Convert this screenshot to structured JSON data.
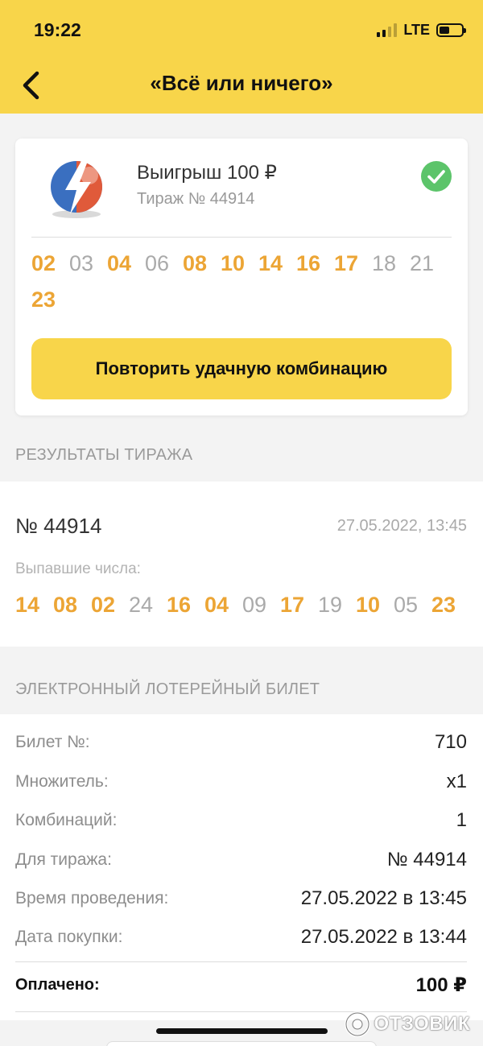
{
  "status_bar": {
    "time": "19:22",
    "network": "LTE",
    "battery_icon": "battery-icon",
    "signal_icon": "signal-icon"
  },
  "nav": {
    "back_icon": "chevron-left-icon",
    "title": "«Всё или ничего»"
  },
  "win_card": {
    "logo_icon": "lightning-ball-logo",
    "title": "Выигрыш 100 ₽",
    "draw": "Тираж № 44914",
    "status_icon": "check-circle-icon",
    "numbers": [
      {
        "n": "02",
        "hit": true
      },
      {
        "n": "03",
        "hit": false
      },
      {
        "n": "04",
        "hit": true
      },
      {
        "n": "06",
        "hit": false
      },
      {
        "n": "08",
        "hit": true
      },
      {
        "n": "10",
        "hit": true
      },
      {
        "n": "14",
        "hit": true
      },
      {
        "n": "16",
        "hit": true
      },
      {
        "n": "17",
        "hit": true
      },
      {
        "n": "18",
        "hit": false
      },
      {
        "n": "21",
        "hit": false
      },
      {
        "n": "23",
        "hit": true
      }
    ],
    "repeat_button": "Повторить удачную комбинацию"
  },
  "results": {
    "section_title": "РЕЗУЛЬТАТЫ ТИРАЖА",
    "draw_no": "№ 44914",
    "date": "27.05.2022, 13:45",
    "drawn_label": "Выпавшие числа:",
    "numbers": [
      {
        "n": "14",
        "hit": true
      },
      {
        "n": "08",
        "hit": true
      },
      {
        "n": "02",
        "hit": true
      },
      {
        "n": "24",
        "hit": false
      },
      {
        "n": "16",
        "hit": true
      },
      {
        "n": "04",
        "hit": true
      },
      {
        "n": "09",
        "hit": false
      },
      {
        "n": "17",
        "hit": true
      },
      {
        "n": "19",
        "hit": false
      },
      {
        "n": "10",
        "hit": true
      },
      {
        "n": "05",
        "hit": false
      },
      {
        "n": "23",
        "hit": true
      }
    ]
  },
  "ticket": {
    "section_title": "ЭЛЕКТРОННЫЙ ЛОТЕРЕЙНЫЙ БИЛЕТ",
    "rows": [
      {
        "label": "Билет №:",
        "value": "710"
      },
      {
        "label": "Множитель:",
        "value": "x1"
      },
      {
        "label": "Комбинаций:",
        "value": "1"
      },
      {
        "label": "Для тиража:",
        "value": "№ 44914"
      },
      {
        "label": "Время проведения:",
        "value": "27.05.2022 в 13:45"
      },
      {
        "label": "Дата покупки:",
        "value": "27.05.2022 в 13:44"
      }
    ],
    "total_label": "Оплачено:",
    "total_value": "100 ₽"
  },
  "watermark": "ОТЗОВИК",
  "colors": {
    "brand_yellow": "#f8d54a",
    "hit_orange": "#eca535",
    "miss_gray": "#aaaaaa",
    "success_green": "#5cc46a"
  }
}
